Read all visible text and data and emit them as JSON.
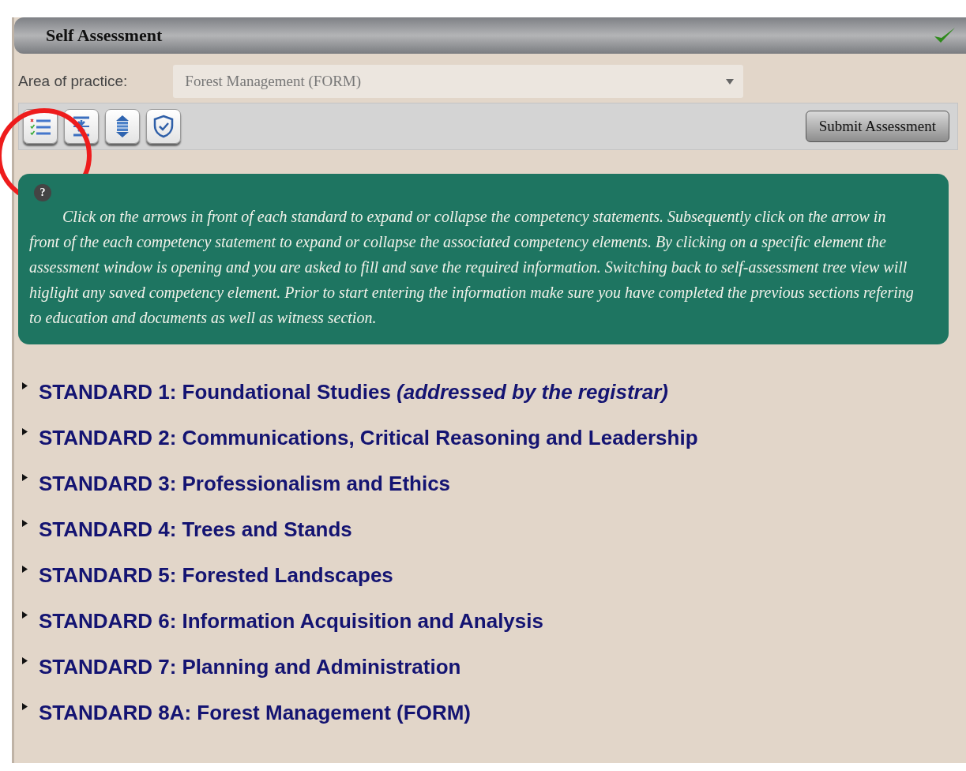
{
  "panel": {
    "title": "Self Assessment",
    "complete": true
  },
  "area": {
    "label": "Area of practice:",
    "value": "Forest Management (FORM)"
  },
  "toolbar": {
    "buttons": [
      {
        "kind": "checklist"
      },
      {
        "kind": "collapse"
      },
      {
        "kind": "expand"
      },
      {
        "kind": "shield"
      }
    ],
    "submit": "Submit Assessment"
  },
  "annotation": {
    "kind": "circle"
  },
  "info": {
    "icon": "?",
    "text": "Click on the arrows in front of each standard to expand or collapse the competency statements. Subsequently click on the arrow in front of the each competency statement to expand or collapse the associated competency elements. By clicking on a specific element the assessment window is opening and you are asked to fill and save the required information. Switching back to self-assessment tree view will higlight any saved competency element. Prior to start entering the information make sure you have completed the previous sections refering to education and documents as well as witness section."
  },
  "standards": [
    {
      "label": "STANDARD 1: Foundational Studies *(addressed by the registrar)*",
      "expanded": false
    },
    {
      "label": "STANDARD 2: Communications, Critical Reasoning and Leadership",
      "expanded": false
    },
    {
      "label": "STANDARD 3: Professionalism and Ethics",
      "expanded": false
    },
    {
      "label": "STANDARD 4: Trees and Stands",
      "expanded": false
    },
    {
      "label": "STANDARD 5: Forested Landscapes",
      "expanded": false
    },
    {
      "label": "STANDARD 6: Information Acquisition and Analysis",
      "expanded": false
    },
    {
      "label": "STANDARD 7: Planning and Administration",
      "expanded": false
    },
    {
      "label": "STANDARD 8A: Forest Management (FORM)",
      "expanded": false
    }
  ]
}
